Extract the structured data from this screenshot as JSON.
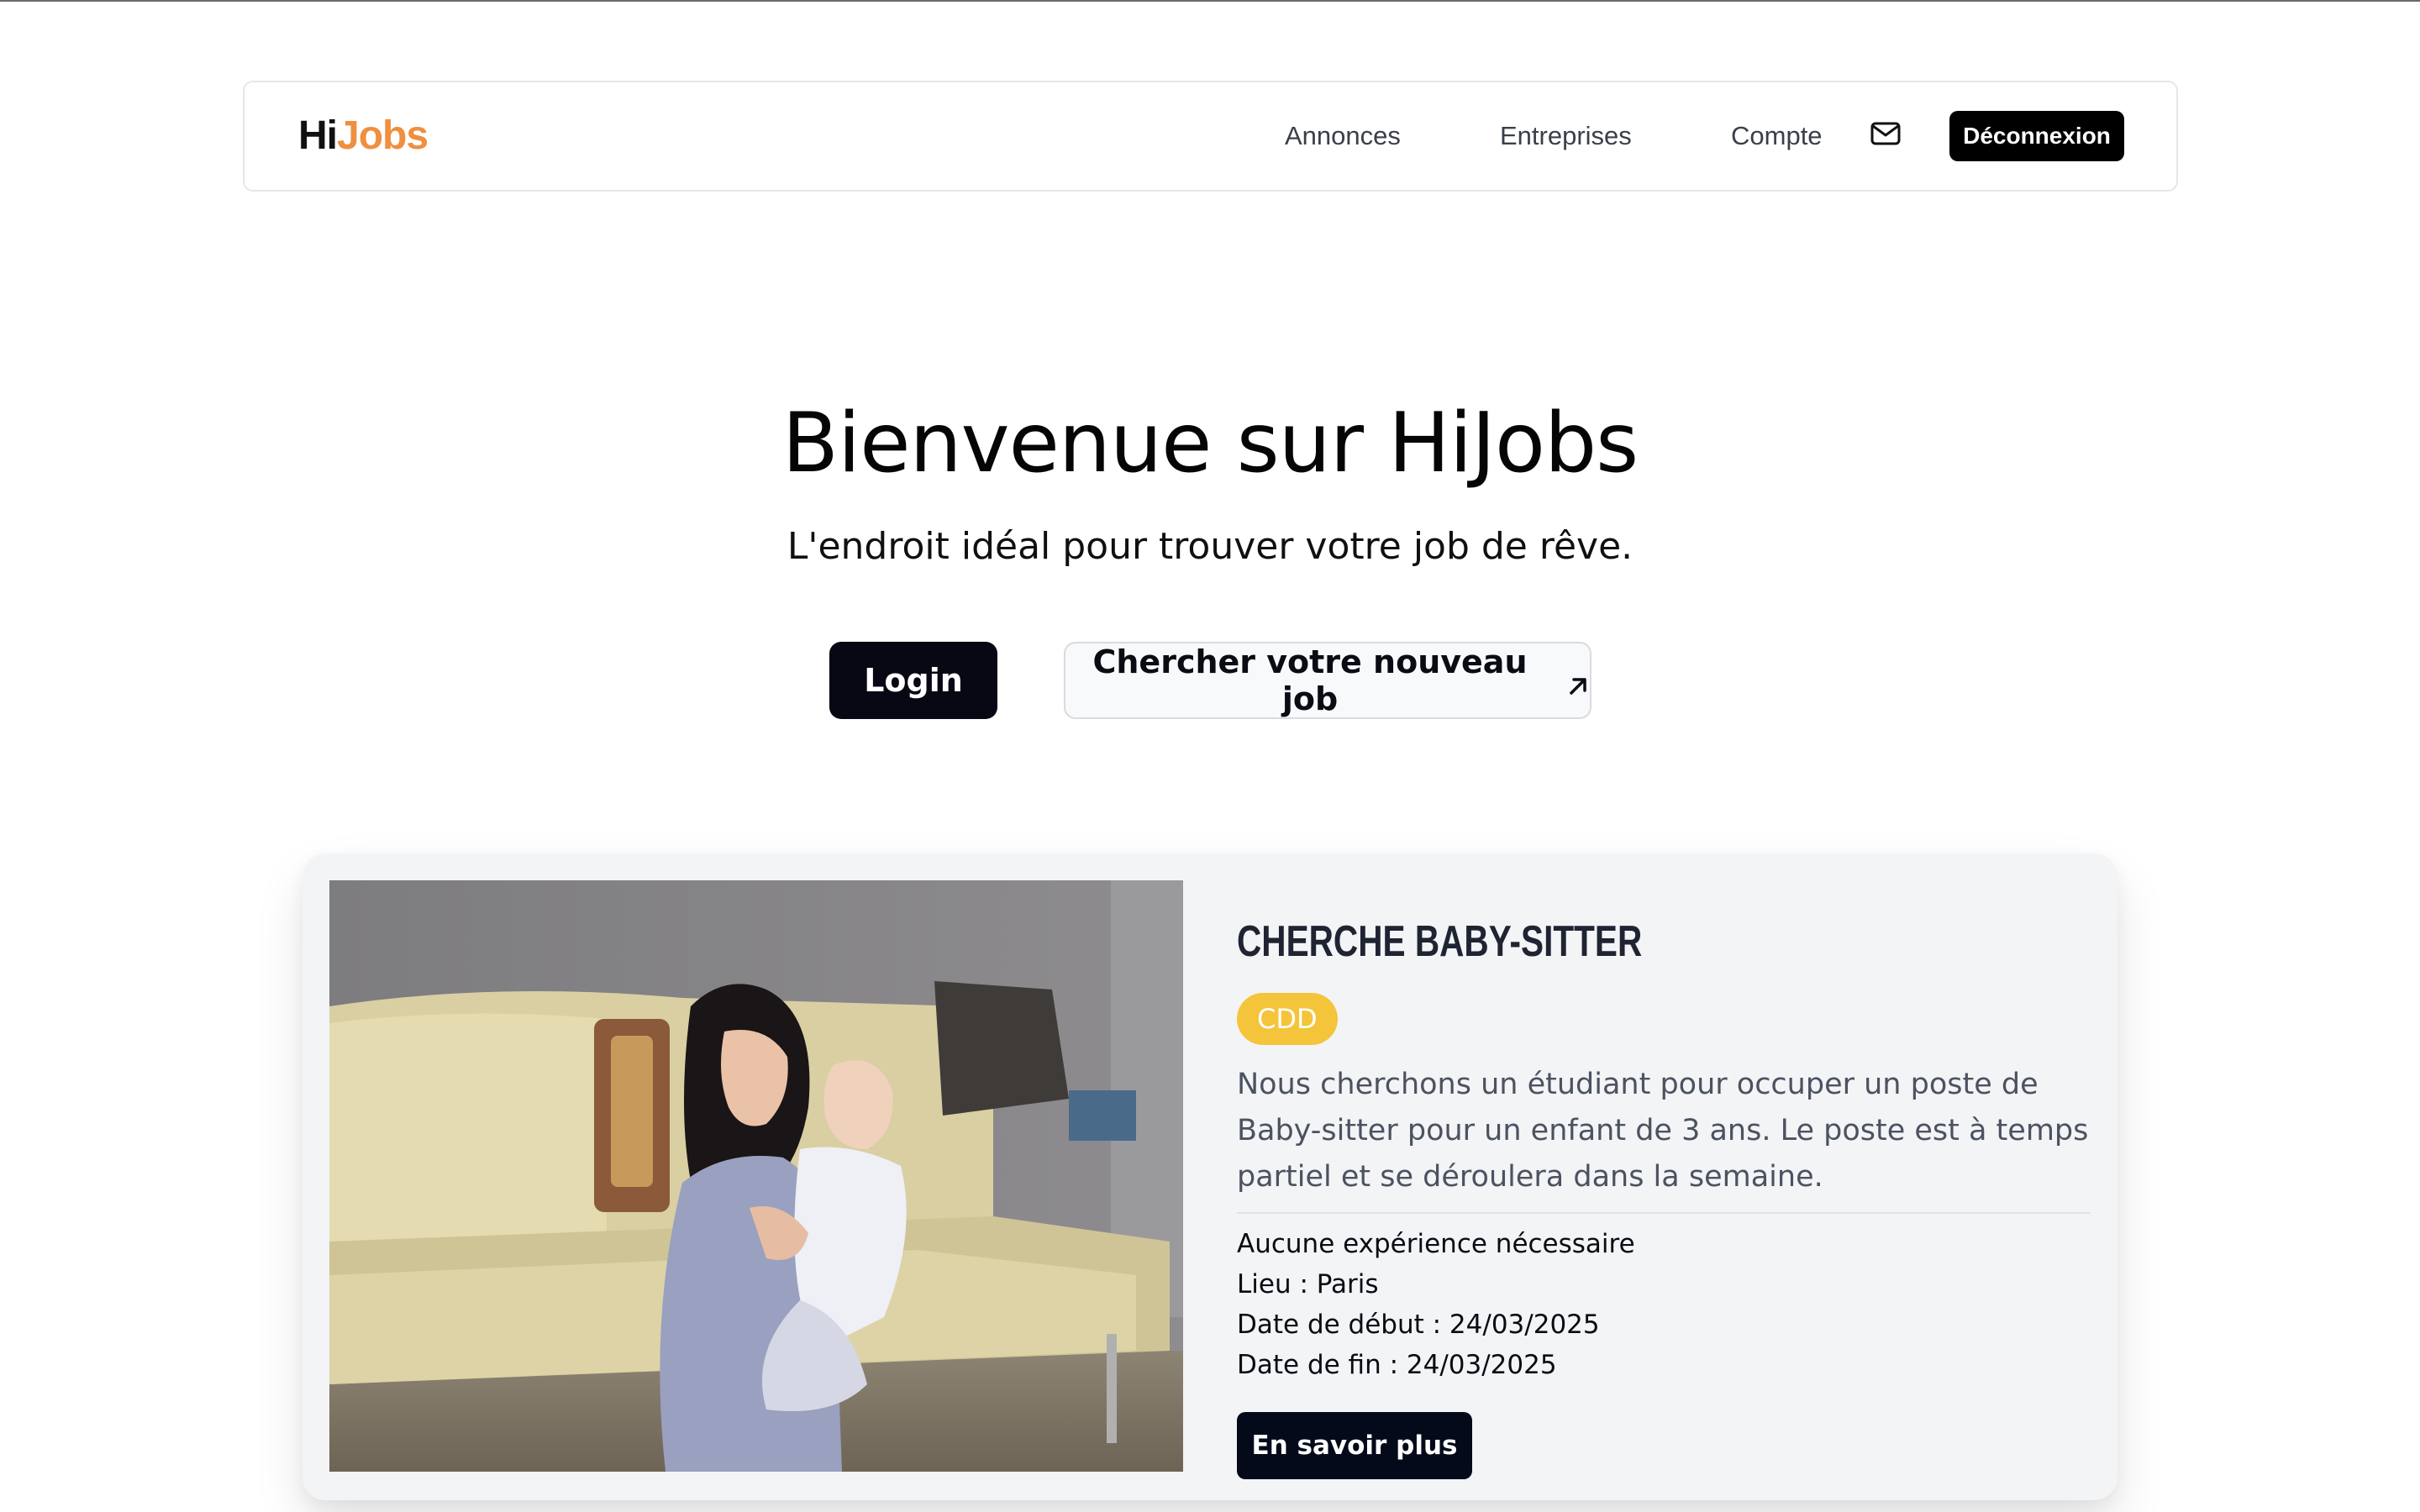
{
  "nav": {
    "logo_hi": "Hi",
    "logo_jobs": "Jobs",
    "links": [
      "Annonces",
      "Entreprises",
      "Compte"
    ],
    "logout_label": "Déconnexion",
    "mail_icon": "mail-icon"
  },
  "hero": {
    "title": "Bienvenue sur HiJobs",
    "subtitle": "L'endroit idéal pour trouver votre job de rêve.",
    "login_label": "Login",
    "search_label": "Chercher votre nouveau job",
    "search_icon": "arrow-up-right-icon"
  },
  "card": {
    "title": "CHERCHE BABY-SITTER",
    "badge": "CDD",
    "description": "Nous cherchons un étudiant pour occuper un poste de Baby-sitter pour un enfant de 3 ans. Le poste est à temps partiel et se déroulera dans la semaine.",
    "experience": "Aucune expérience nécessaire",
    "location": "Lieu : Paris",
    "start_date": "Date de début : 24/03/2025",
    "end_date": "Date de fin : 24/03/2025",
    "more_label": "En savoir plus"
  },
  "colors": {
    "accent_orange": "#ef8f3f",
    "badge_yellow": "#f4c43a",
    "primary_dark": "#080814"
  }
}
